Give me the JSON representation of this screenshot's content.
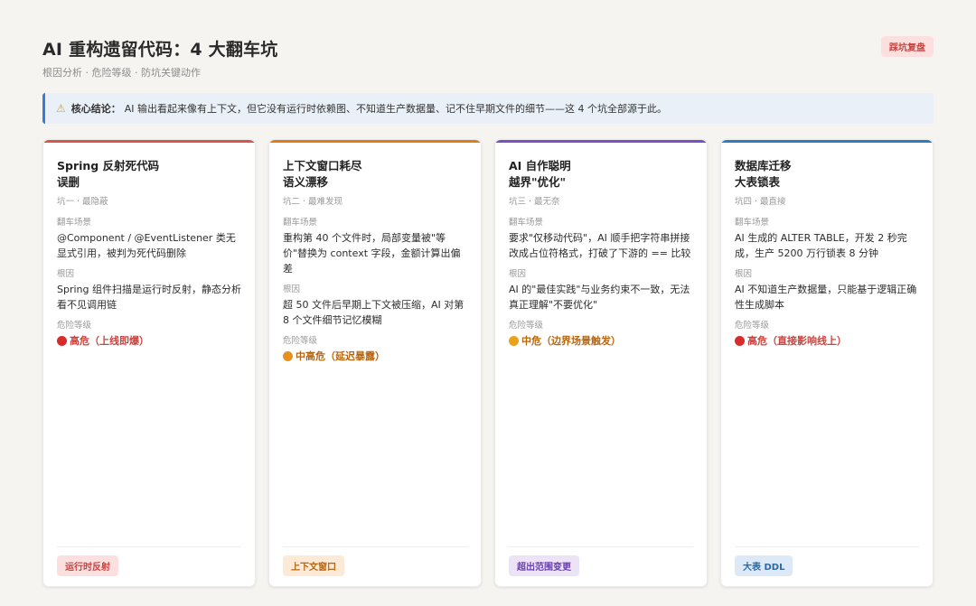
{
  "header": {
    "title": "AI 重构遗留代码：4 大翻车坑",
    "subtitle": "根因分析 · 危险等级 · 防坑关键动作",
    "review_badge": "踩坑复盘"
  },
  "callout": {
    "icon": "warning-icon",
    "lead": "核心结论：",
    "text": "AI 输出看起来像有上下文，但它没有运行时依赖图、不知道生产数据量、记不住早期文件的细节——这 4 个坑全部源于此。"
  },
  "labels": {
    "scenario": "翻车场景",
    "root_cause": "根因",
    "risk": "危险等级"
  },
  "cards": [
    {
      "title_line1": "Spring 反射死代码",
      "title_line2": "误删",
      "meta": "坑一 · 最隐蔽",
      "scenario": "@Component / @EventListener 类无显式引用，被判为死代码删除",
      "root_cause": "Spring 组件扫描是运行时反射，静态分析看不见调用链",
      "risk": "高危（上线即爆）",
      "tag": "运行时反射",
      "accent": "#d9534f",
      "risk_color": "#c9433f",
      "dot_color": "#d62c2c",
      "tag_bg": "#fbe0df",
      "tag_fg": "#c9433f"
    },
    {
      "title_line1": "上下文窗口耗尽",
      "title_line2": "语义漂移",
      "meta": "坑二 · 最难发现",
      "scenario": "重构第 40 个文件时，局部变量被\"等价\"替换为 context 字段，金额计算出偏差",
      "root_cause": "超 50 文件后早期上下文被压缩，AI 对第 8 个文件细节记忆模糊",
      "risk": "中高危（延迟暴露）",
      "tag": "上下文窗口",
      "accent": "#e07b1a",
      "risk_color": "#b8650f",
      "dot_color": "#e8901c",
      "tag_bg": "#fcead6",
      "tag_fg": "#b8650f"
    },
    {
      "title_line1": "AI 自作聪明",
      "title_line2": "越界\"优化\"",
      "meta": "坑三 · 最无奈",
      "scenario": "要求\"仅移动代码\"，AI 顺手把字符串拼接改成占位符格式，打破了下游的 == 比较",
      "root_cause": "AI 的\"最佳实践\"与业务约束不一致，无法真正理解\"不要优化\"",
      "risk": "中危（边界场景触发）",
      "tag": "超出范围变更",
      "accent": "#7b4fc2",
      "risk_color": "#b8650f",
      "dot_color": "#e8a21c",
      "tag_bg": "#ece3f7",
      "tag_fg": "#6a3fb0"
    },
    {
      "title_line1": "数据库迁移",
      "title_line2": "大表锁表",
      "meta": "坑四 · 最直接",
      "scenario": "AI 生成的 ALTER TABLE，开发 2 秒完成，生产 5200 万行锁表 8 分钟",
      "root_cause": "AI 不知道生产数据量，只能基于逻辑正确性生成脚本",
      "risk": "高危（直接影响线上）",
      "tag": "大表 DDL",
      "accent": "#2f7bbf",
      "risk_color": "#c9433f",
      "dot_color": "#d62c2c",
      "tag_bg": "#dde9f6",
      "tag_fg": "#2a6aa8"
    }
  ]
}
